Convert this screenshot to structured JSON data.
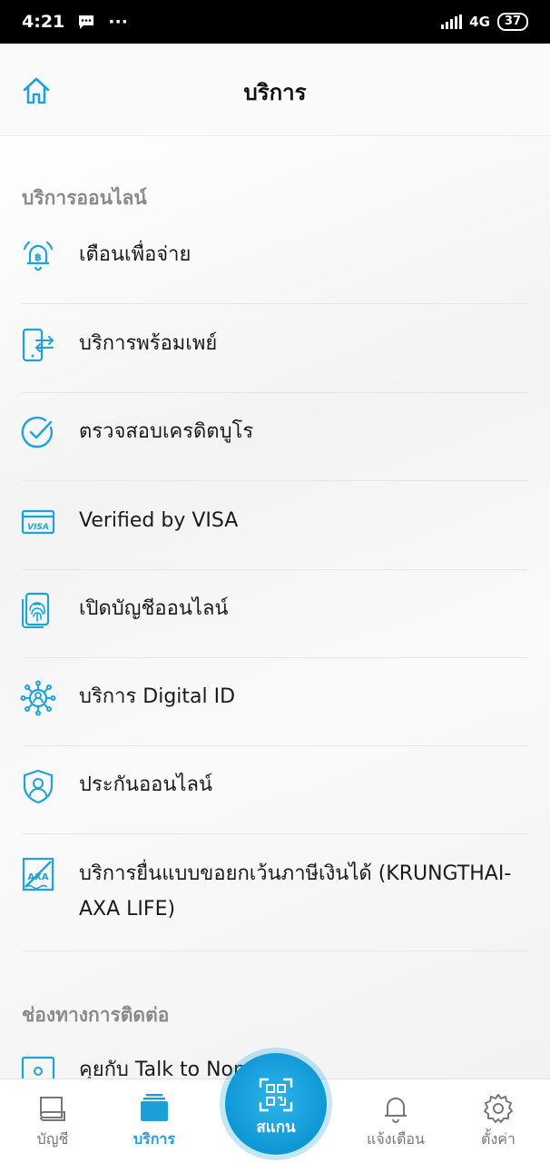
{
  "status_bar": {
    "time": "4:21",
    "network": "4G",
    "battery": "37"
  },
  "header": {
    "title": "บริการ"
  },
  "sections": [
    {
      "title": "บริการออนไลน์",
      "items": [
        {
          "label": "เตือนเพื่อจ่าย",
          "icon": "bell-baht-icon"
        },
        {
          "label": "บริการพร้อมเพย์",
          "icon": "phone-transfer-icon"
        },
        {
          "label": "ตรวจสอบเครดิตบูโร",
          "icon": "check-circle-icon"
        },
        {
          "label": "Verified by VISA",
          "icon": "visa-card-icon"
        },
        {
          "label": "เปิดบัญชีออนไลน์",
          "icon": "fingerprint-phone-icon"
        },
        {
          "label": "บริการ Digital ID",
          "icon": "digital-id-network-icon"
        },
        {
          "label": "ประกันออนไลน์",
          "icon": "shield-user-icon"
        },
        {
          "label": "บริการยื่นแบบขอยกเว้นภาษีเงินได้ (KRUNGTHAI-AXA LIFE)",
          "icon": "axa-document-icon"
        }
      ]
    },
    {
      "title": "ช่องทางการติดต่อ",
      "items": [
        {
          "label": "คุยกับ Talk to Nong Fah",
          "icon": "chat-icon"
        }
      ]
    }
  ],
  "bottom_nav": {
    "account": "บัญชี",
    "services": "บริการ",
    "scan": "สแกน",
    "notifications": "แจ้งเตือน",
    "settings": "ตั้งค่า"
  },
  "colors": {
    "accent": "#1a9fd9",
    "icon": "#1ea3d6"
  }
}
